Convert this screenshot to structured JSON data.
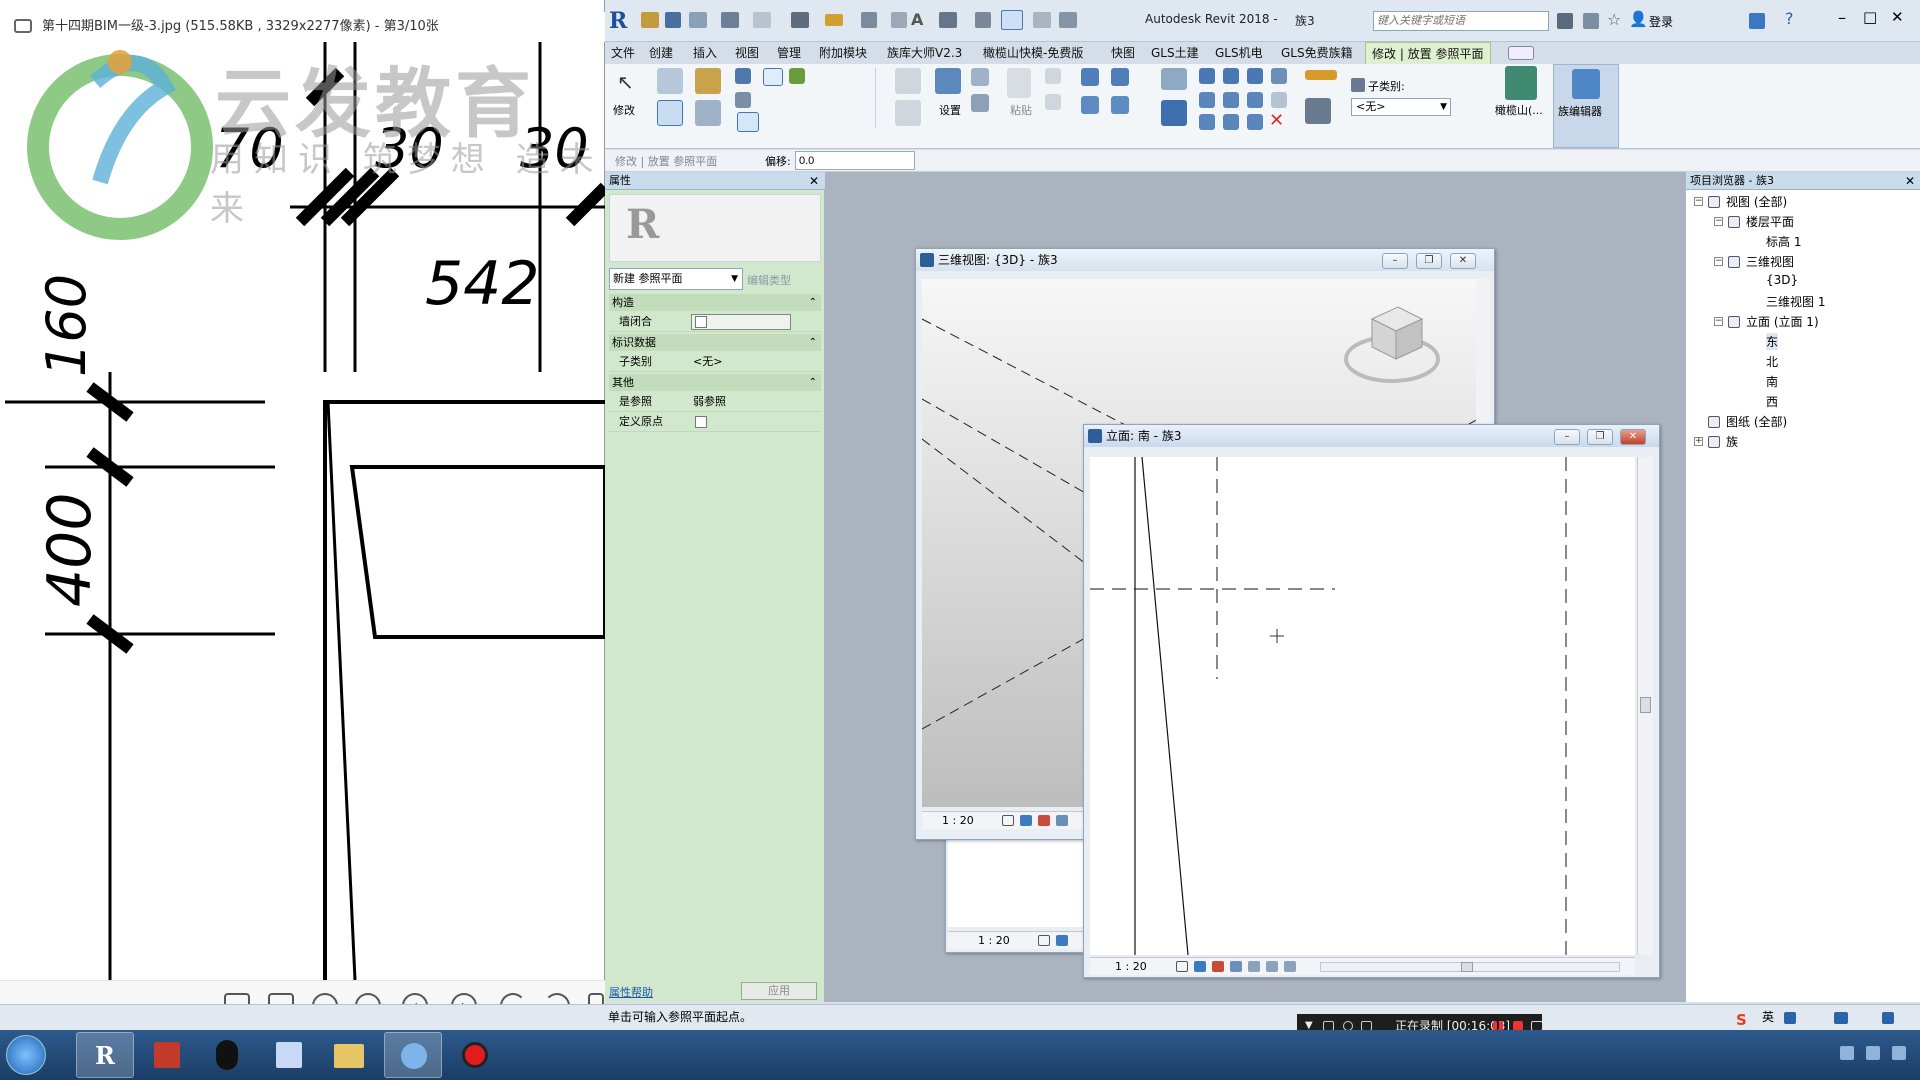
{
  "viewer": {
    "title": "第十四期BIM一级-3.jpg (515.58KB , 3329x2277像素) - 第3/10张",
    "watermark_main": "云发教育",
    "watermark_slogan": "用知识 筑梦想 造未来",
    "dims": [
      "70",
      "30",
      "30",
      "542",
      "160",
      "400"
    ],
    "tools": [
      "edit-icon",
      "crop-icon",
      "zoom-in-icon",
      "zoom-out-icon",
      "prev-icon",
      "next-icon",
      "rotate-left-icon",
      "rotate-right-icon",
      "delete-icon"
    ]
  },
  "revit": {
    "app_title": "Autodesk Revit 2018 -",
    "doc_name": "族3",
    "search_placeholder": "键入关键字或短语",
    "login": "登录",
    "tabs": [
      "文件",
      "创建",
      "插入",
      "视图",
      "管理",
      "附加模块",
      "族库大师V2.3",
      "橄榄山快模-免费版",
      "快图",
      "GLS土建",
      "GLS机电",
      "GLS免费族籍",
      "修改 | 放置 参照平面"
    ],
    "active_tab": "修改 | 放置 参照平面",
    "ribbon": {
      "modify_label": "修改",
      "settings_label": "设置",
      "paste_label": "粘贴",
      "subcategory_label": "子类别:",
      "subcategory_value": "<无>",
      "olive_label": "橄榄山(...",
      "family_editor_label": "族编辑器"
    },
    "optbar": {
      "context": "修改 | 放置 参照平面",
      "offset_label": "偏移:",
      "offset_value": "0.0"
    }
  },
  "properties": {
    "title": "属性",
    "type_selector": "新建 参照平面",
    "edit_type": "编辑类型",
    "sections": [
      {
        "name": "构造",
        "rows": [
          {
            "label": "墙闭合",
            "value": ""
          }
        ]
      },
      {
        "name": "标识数据",
        "rows": [
          {
            "label": "子类别",
            "value": "<无>"
          }
        ]
      },
      {
        "name": "其他",
        "rows": [
          {
            "label": "是参照",
            "value": "弱参照"
          },
          {
            "label": "定义原点",
            "value": ""
          }
        ]
      }
    ],
    "help_link": "属性帮助",
    "apply": "应用"
  },
  "browser": {
    "title": "项目浏览器 - 族3",
    "items": [
      {
        "label": "视图 (全部)",
        "level": 0,
        "toggle": "−"
      },
      {
        "label": "楼层平面",
        "level": 1,
        "toggle": "−"
      },
      {
        "label": "标高 1",
        "level": 2,
        "toggle": ""
      },
      {
        "label": "三维视图",
        "level": 1,
        "toggle": "−"
      },
      {
        "label": "{3D}",
        "level": 2,
        "toggle": ""
      },
      {
        "label": "三维视图 1",
        "level": 2,
        "toggle": ""
      },
      {
        "label": "立面 (立面 1)",
        "level": 1,
        "toggle": "−"
      },
      {
        "label": "东",
        "level": 2,
        "toggle": ""
      },
      {
        "label": "北",
        "level": 2,
        "toggle": ""
      },
      {
        "label": "南",
        "level": 2,
        "toggle": ""
      },
      {
        "label": "西",
        "level": 2,
        "toggle": ""
      },
      {
        "label": "图纸 (全部)",
        "level": 0,
        "toggle": ""
      },
      {
        "label": "族",
        "level": 0,
        "toggle": "+"
      }
    ]
  },
  "windows": {
    "view3d": {
      "title": "三维视图: {3D} - 族3",
      "scale": "1 : 20"
    },
    "hidden": {
      "scale": "1 : 20"
    },
    "south": {
      "title": "立面: 南 - 族3",
      "scale": "1 : 20"
    }
  },
  "status": {
    "message": "单击可输入参照平面起点。",
    "recording": "正在录制 [00:16:03]",
    "ime": "英"
  },
  "colors": {
    "ribbon_accent": "#dff0d0",
    "props_bg": "#d2e8cc",
    "taskbar": "#1b3d66"
  }
}
